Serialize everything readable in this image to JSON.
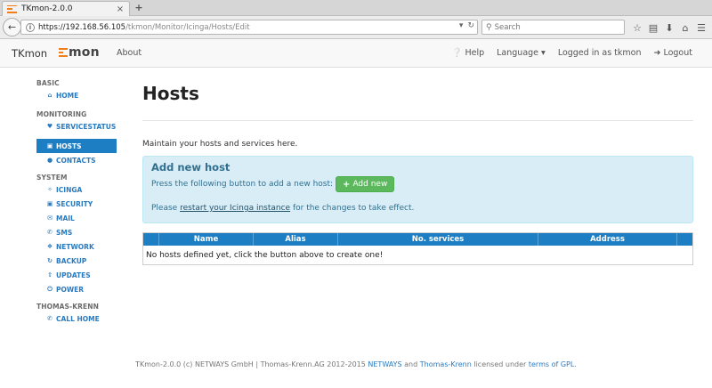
{
  "browser": {
    "tab_title": "TKmon-2.0.0",
    "tab_close": "×",
    "new_tab": "+",
    "url_host": "https://192.168.56.105",
    "url_path": "/tkmon/Monitor/Icinga/Hosts/Edit",
    "search_placeholder": "Search"
  },
  "appnav": {
    "brand": "TKmon",
    "logo_text": "mon",
    "about": "About",
    "help": "Help",
    "language": "Language",
    "logged_in": "Logged in as tkmon",
    "logout": "Logout"
  },
  "sidebar": {
    "sections": {
      "basic": "BASIC",
      "monitoring": "MONITORING",
      "system": "SYSTEM",
      "thomas_krenn": "THOMAS-KRENN"
    },
    "items": {
      "home": "HOME",
      "servicestatus": "SERVICESTATUS",
      "hosts": "HOSTS",
      "contacts": "CONTACTS",
      "icinga": "ICINGA",
      "security": "SECURITY",
      "mail": "MAIL",
      "sms": "SMS",
      "network": "NETWORK",
      "backup": "BACKUP",
      "updates": "UPDATES",
      "power": "POWER",
      "call_home": "CALL HOME"
    }
  },
  "main": {
    "title": "Hosts",
    "description": "Maintain your hosts and services here.",
    "add_box": {
      "heading": "Add new host",
      "instruction": "Press the following button to add a new host:",
      "button": "Add new",
      "restart_prefix": "Please",
      "restart_link": "restart your Icinga instance",
      "restart_suffix": "for the changes to take effect."
    },
    "table": {
      "columns": [
        "",
        "Name",
        "Alias",
        "No. services",
        "Address",
        ""
      ],
      "empty_message": "No hosts defined yet, click the button above to create one!"
    }
  },
  "footer": {
    "prefix": "TKmon-2.0.0 (c) NETWAYS GmbH | Thomas-Krenn.AG 2012-2015",
    "netways": "NETWAYS",
    "and": "and",
    "thomas_krenn": "Thomas-Krenn",
    "licensed": "licensed under",
    "license_link": "terms of GPL",
    "period": "."
  }
}
